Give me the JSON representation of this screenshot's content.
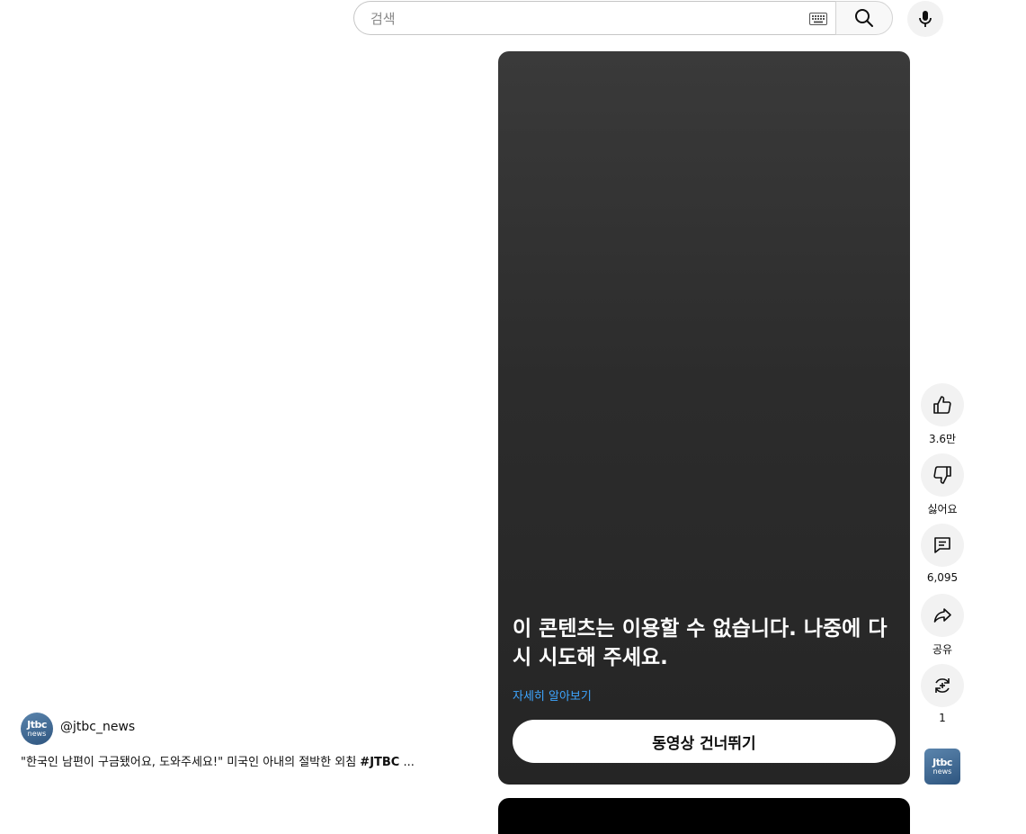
{
  "search": {
    "placeholder": "검색",
    "keyboard_icon": "keyboard-icon",
    "search_icon": "search-icon",
    "mic_icon": "microphone-icon"
  },
  "player": {
    "error_message": "이 콘텐츠는 이용할 수 없습니다. 나중에 다시 시도해 주세요.",
    "learn_more": "자세히 알아보기",
    "skip_button": "동영상 건너뛰기"
  },
  "actions": {
    "like_count": "3.6만",
    "dislike_label": "싫어요",
    "comment_count": "6,095",
    "share_label": "공유",
    "remix_count": "1"
  },
  "channel": {
    "handle": "@jtbc_news",
    "logo_top": "Jtbc",
    "logo_bottom": "news"
  },
  "video": {
    "title": "\"한국인 남편이 구금됐어요, 도와주세요!\" 미국인 아내의 절박한 외침 ",
    "hashtag": "#JTBC",
    "ellipsis": " ..."
  },
  "colors": {
    "link": "#3ea6ff",
    "card_bg": "#2c2c2c",
    "button_bg": "#f2f2f2"
  }
}
